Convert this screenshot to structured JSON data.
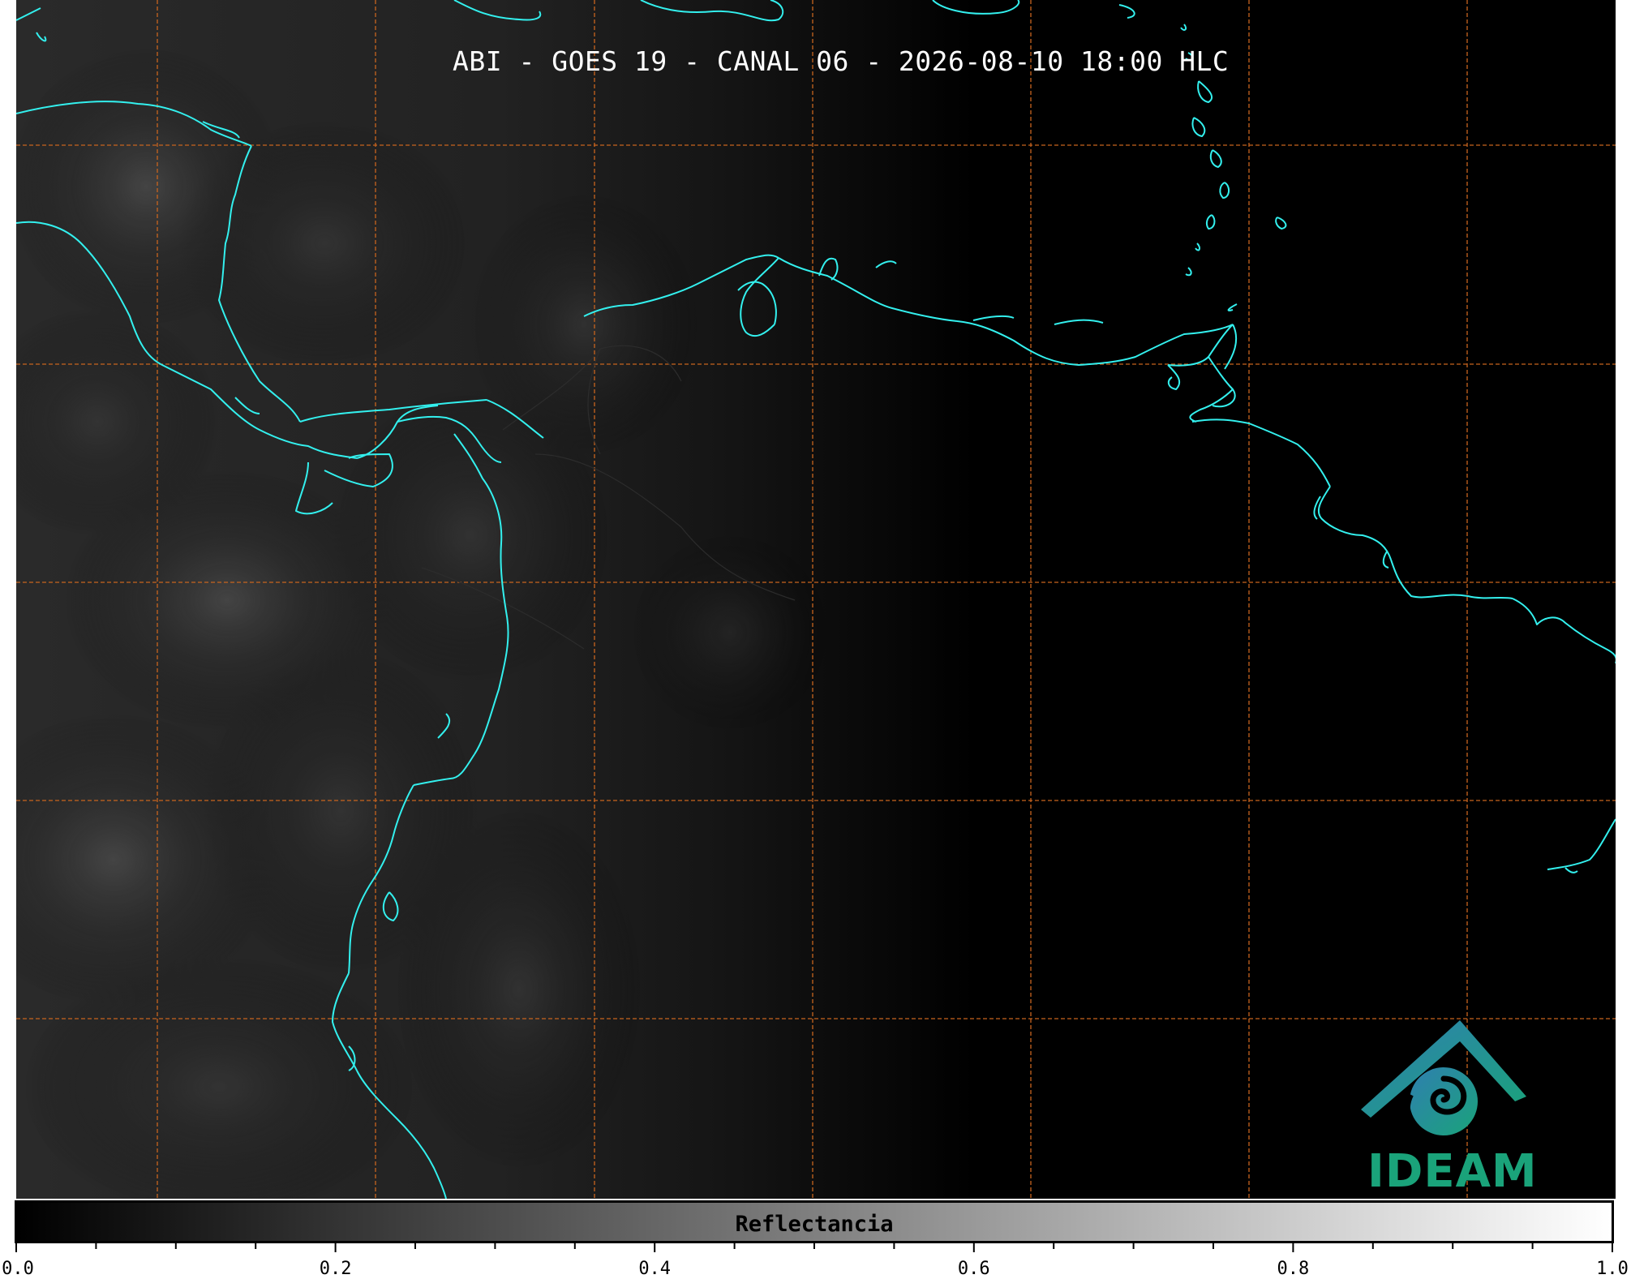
{
  "title": "ABI - GOES 19 - CANAL 06 - 2026-08-10 18:00 HLC",
  "colors": {
    "coastline": "#33f0ee",
    "border": "#2a2a2a",
    "grid": "#c8641e",
    "background": "#000000",
    "logo_teal": "#1aa37a",
    "logo_blue": "#2f7fb0"
  },
  "colorbar": {
    "label": "Reflectancia",
    "range": [
      0.0,
      1.0
    ],
    "colormap": "grayscale",
    "tick_labels": [
      "0.0",
      "0.2",
      "0.4",
      "0.6",
      "0.8",
      "1.0"
    ]
  },
  "logo": {
    "name": "IDEAM",
    "icon": "ideam-logo-icon"
  }
}
